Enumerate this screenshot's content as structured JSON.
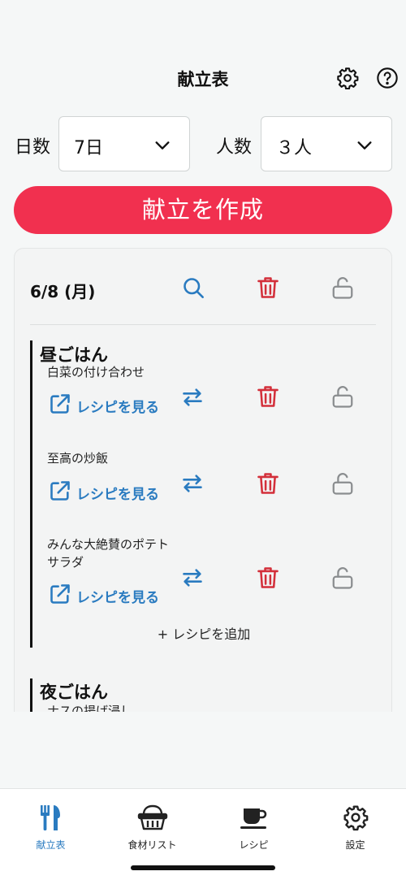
{
  "header": {
    "title": "献立表",
    "settings_icon": "gear-icon",
    "help_icon": "help-circle-icon"
  },
  "days_field": {
    "label": "日数",
    "value": "7日"
  },
  "people_field": {
    "label": "人数",
    "value": "３人"
  },
  "create_button": {
    "label": "献立を作成",
    "color": "#f1304f"
  },
  "day": {
    "title": "6/8 (月)",
    "actions": [
      "search-icon",
      "trash-icon",
      "unlock-icon"
    ],
    "meals": [
      {
        "title": "昼ごはん",
        "recipes": [
          {
            "name": "白菜の付け合わせ",
            "link": "レシピを見る"
          },
          {
            "name": "至高の炒飯",
            "link": "レシピを見る"
          },
          {
            "name": "みんな大絶賛のポテトサラダ",
            "link": "レシピを見る"
          }
        ],
        "add_label": "+ レシピを追加"
      },
      {
        "title": "夜ごはん",
        "recipes": [
          {
            "name": "ナスの揚げ浸し"
          }
        ]
      }
    ]
  },
  "tabs": [
    {
      "label": "献立表",
      "icon": "utensils-icon",
      "active": true
    },
    {
      "label": "食材リスト",
      "icon": "basket-icon",
      "active": false
    },
    {
      "label": "レシピ",
      "icon": "cup-icon",
      "active": false
    },
    {
      "label": "設定",
      "icon": "gear-icon",
      "active": false
    }
  ],
  "colors": {
    "accent_blue": "#2a7bc0",
    "delete_red": "#d32f3a",
    "lock_gray": "#8a8d8f"
  }
}
